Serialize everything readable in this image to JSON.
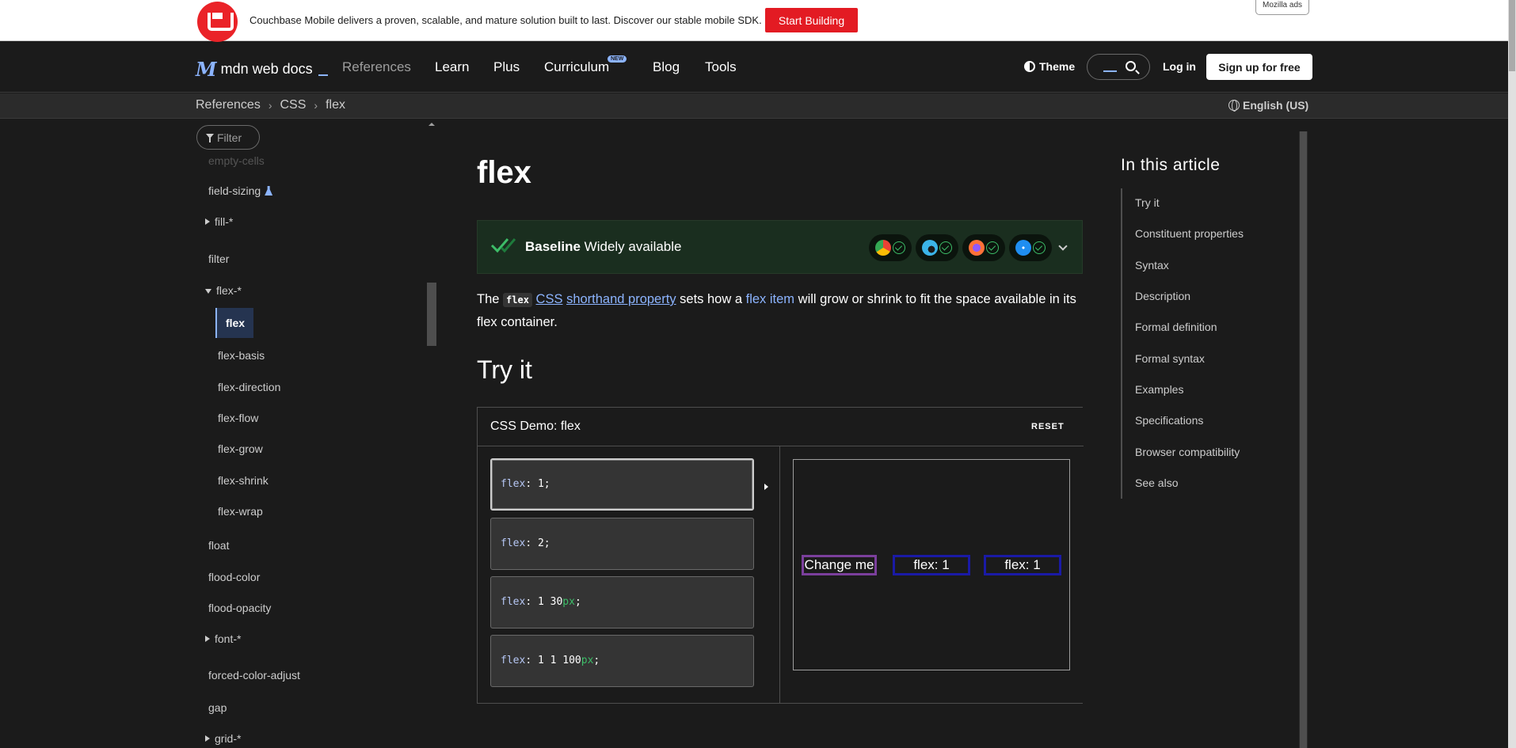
{
  "ad": {
    "text": "Couchbase Mobile delivers a proven, scalable, and mature solution built to last. Discover our stable mobile SDK.",
    "button": "Start Building",
    "tag": "Mozilla ads",
    "brand_color": "#ea2328"
  },
  "nav": {
    "logo": "mdn web docs",
    "links": [
      "References",
      "Learn",
      "Plus",
      "Curriculum",
      "Blog",
      "Tools"
    ],
    "new_badge": "NEW",
    "theme": "Theme",
    "login": "Log in",
    "signup": "Sign up for free"
  },
  "breadcrumb": {
    "items": [
      "References",
      "CSS",
      "flex"
    ],
    "language": "English (US)"
  },
  "sidebar": {
    "filter_placeholder": "Filter",
    "items": [
      "empty-cells",
      "field-sizing",
      "fill-*",
      "filter",
      "flex-*",
      "flex",
      "flex-basis",
      "flex-direction",
      "flex-flow",
      "flex-grow",
      "flex-shrink",
      "flex-wrap",
      "float",
      "flood-color",
      "flood-opacity",
      "font-*",
      "forced-color-adjust",
      "gap",
      "grid-*"
    ],
    "active": "flex"
  },
  "article": {
    "title": "flex",
    "baseline_bold": "Baseline",
    "baseline_rest": " Widely available",
    "desc": {
      "p1": "The ",
      "code": "flex",
      "p2": " ",
      "link_css": "CSS",
      "p3": " ",
      "link_shorthand": "shorthand property",
      "p4": " sets how a ",
      "link_item": "flex item",
      "p5": " will grow or shrink to fit the space available in its flex container."
    },
    "try_it": "Try it"
  },
  "demo": {
    "title": "CSS Demo: flex",
    "reset": "RESET",
    "options": [
      {
        "prop": "flex",
        "value": ": 1;",
        "num": "",
        "unit": "",
        "end": ""
      },
      {
        "prop": "flex",
        "value": ": 2;",
        "num": "",
        "unit": "",
        "end": ""
      },
      {
        "prop": "flex",
        "value": ": 1 ",
        "num": "30",
        "unit": "px",
        "end": ";"
      },
      {
        "prop": "flex",
        "value": ": 1 1 ",
        "num": "100",
        "unit": "px",
        "end": ";"
      }
    ],
    "preview_items": [
      "Change me",
      "flex: 1",
      "flex: 1"
    ]
  },
  "toc": {
    "title": "In this article",
    "items": [
      "Try it",
      "Constituent properties",
      "Syntax",
      "Description",
      "Formal definition",
      "Formal syntax",
      "Examples",
      "Specifications",
      "Browser compatibility",
      "See also"
    ]
  }
}
